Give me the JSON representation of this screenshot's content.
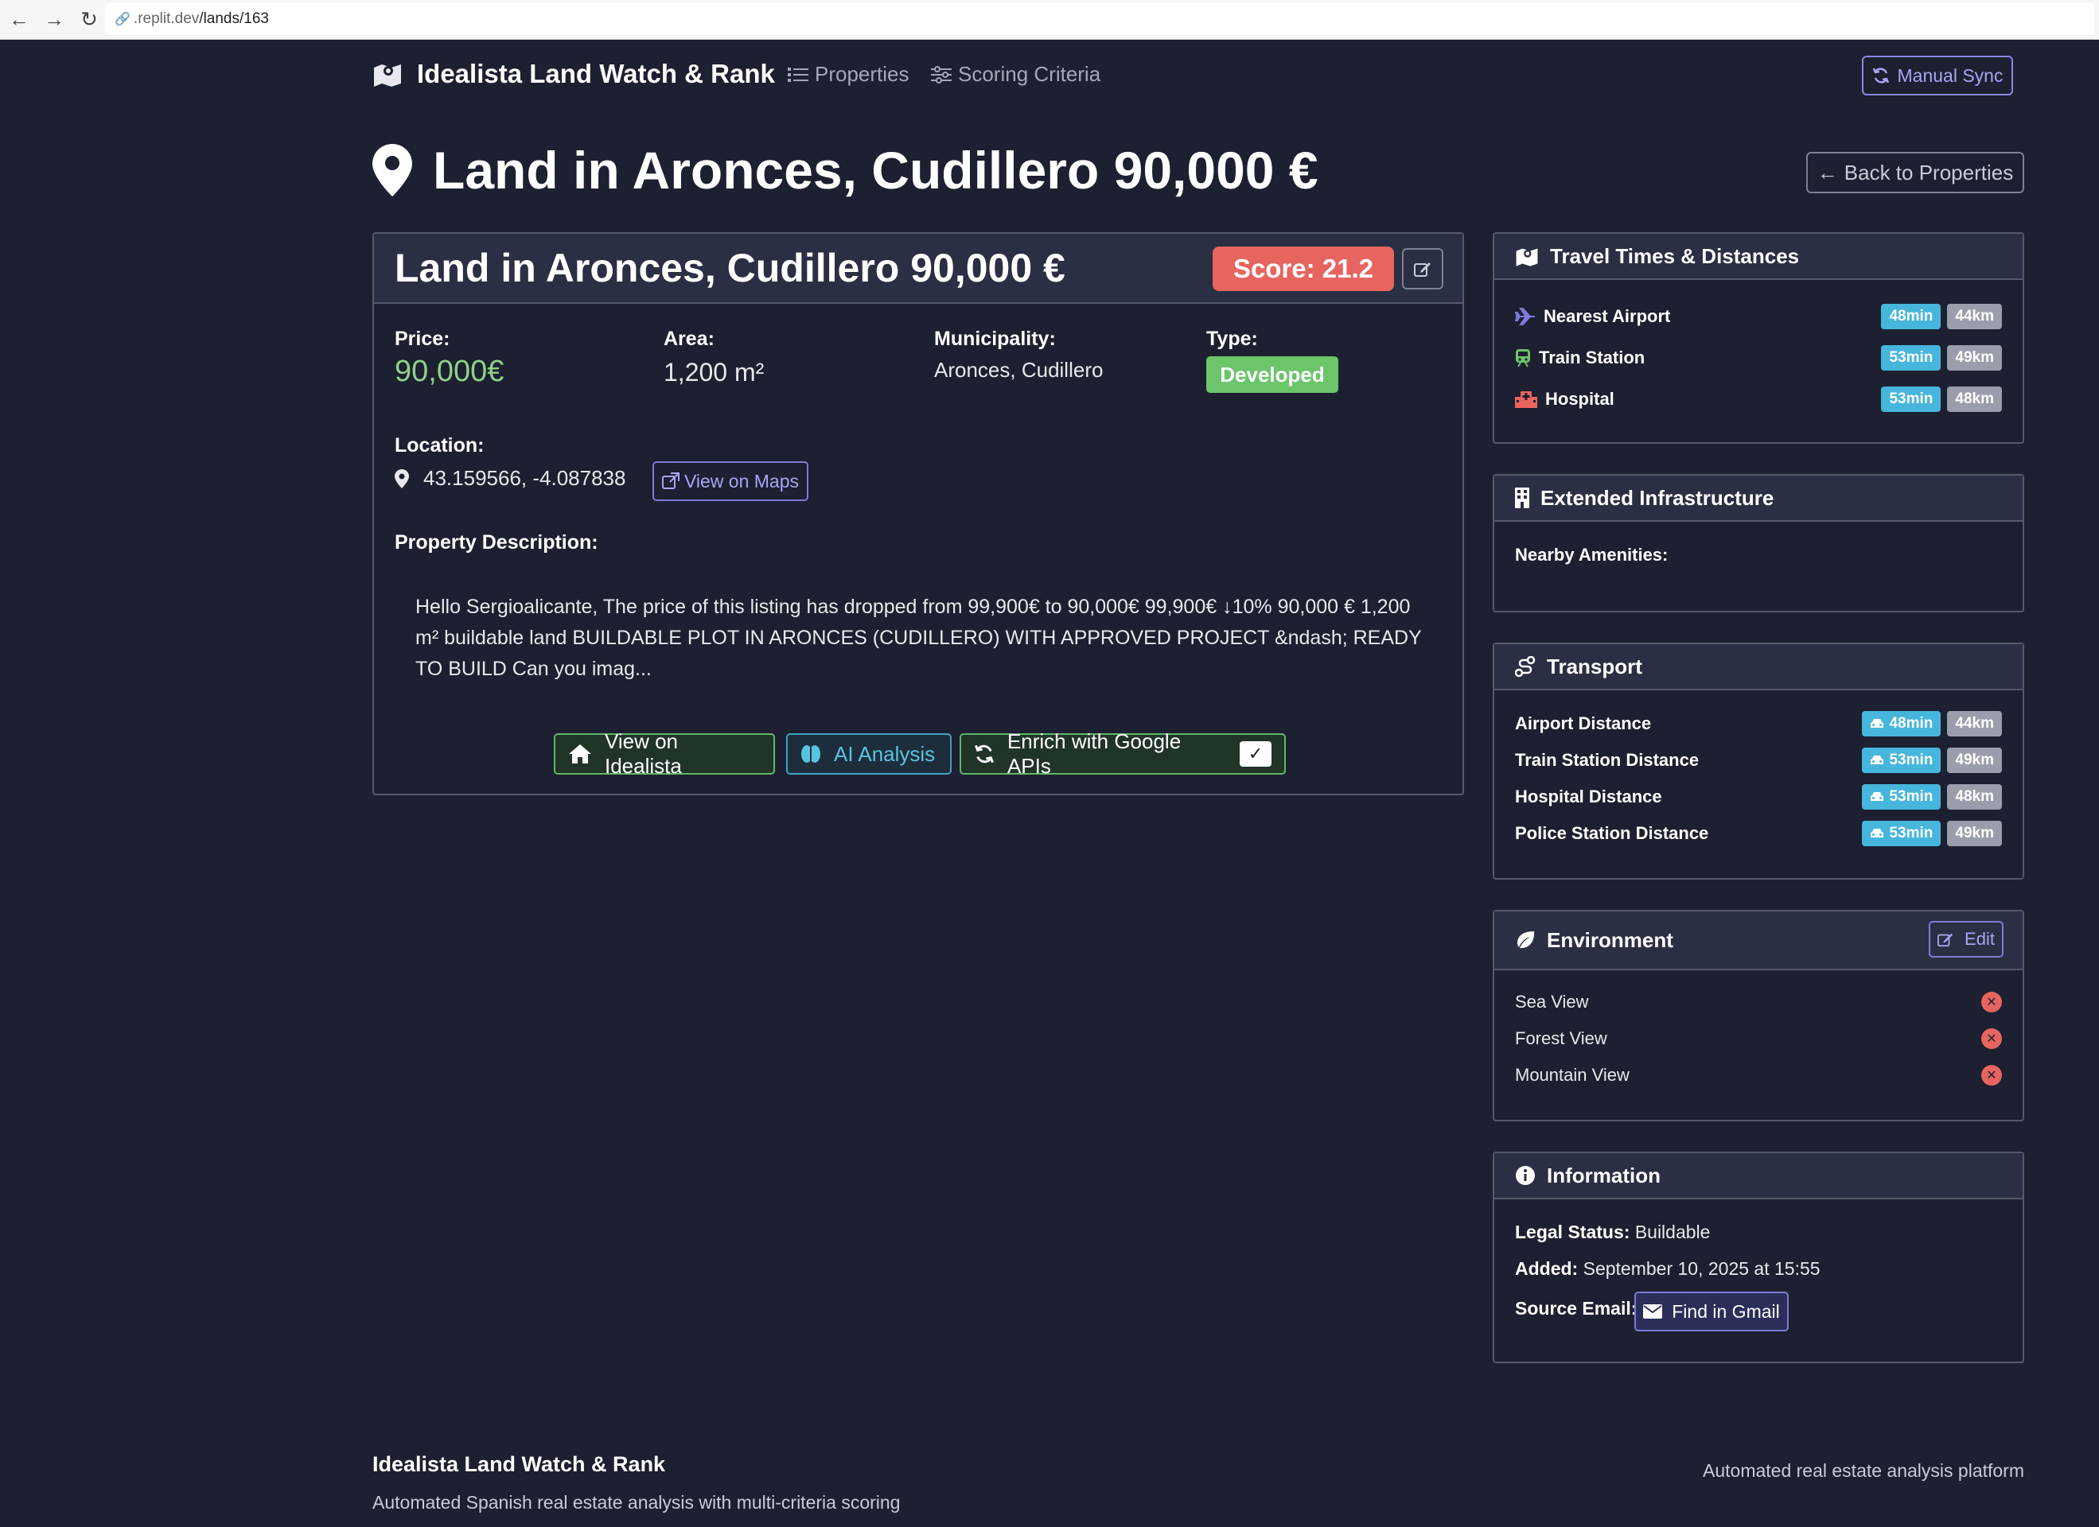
{
  "browser": {
    "url_host": ".replit.dev",
    "url_path": "/lands/163"
  },
  "navbar": {
    "brand": "Idealista Land Watch & Rank",
    "links": [
      "Properties",
      "Scoring Criteria"
    ],
    "sync_button": "Manual Sync"
  },
  "page": {
    "title": "Land in Aronces, Cudillero 90,000 €",
    "back_button": "Back to Properties"
  },
  "property": {
    "card_title": "Land in Aronces, Cudillero 90,000 €",
    "score": "Score: 21.2",
    "price_label": "Price:",
    "price_value": "90,000€",
    "area_label": "Area:",
    "area_value": "1,200 m²",
    "municipality_label": "Municipality:",
    "municipality_value": "Aronces, Cudillero",
    "type_label": "Type:",
    "type_value": "Developed",
    "location_label": "Location:",
    "coordinates": "43.159566, -4.087838",
    "maps_button": "View on Maps",
    "description_label": "Property Description:",
    "description": "Hello Sergioalicante, The price of this listing has dropped from 99,900€ to 90,000€ 99,900€ ↓10% 90,000 € 1,200 m² buildable land BUILDABLE PLOT IN ARONCES (CUDILLERO) WITH APPROVED PROJECT &ndash; READY TO BUILD Can you imag...",
    "actions": {
      "idealista": "View on Idealista",
      "ai": "AI Analysis",
      "enrich": "Enrich with Google APIs",
      "enrich_check": "✓"
    }
  },
  "travel": {
    "title": "Travel Times & Distances",
    "rows": [
      {
        "label": "Nearest Airport",
        "time": "48min",
        "dist": "44km"
      },
      {
        "label": "Train Station",
        "time": "53min",
        "dist": "49km"
      },
      {
        "label": "Hospital",
        "time": "53min",
        "dist": "48km"
      }
    ]
  },
  "infrastructure": {
    "title": "Extended Infrastructure",
    "amenities_label": "Nearby Amenities:"
  },
  "transport": {
    "title": "Transport",
    "rows": [
      {
        "label": "Airport Distance",
        "time": "48min",
        "dist": "44km"
      },
      {
        "label": "Train Station Distance",
        "time": "53min",
        "dist": "49km"
      },
      {
        "label": "Hospital Distance",
        "time": "53min",
        "dist": "48km"
      },
      {
        "label": "Police Station Distance",
        "time": "53min",
        "dist": "49km"
      }
    ]
  },
  "environment": {
    "title": "Environment",
    "edit_button": "Edit",
    "rows": [
      "Sea View",
      "Forest View",
      "Mountain View"
    ]
  },
  "information": {
    "title": "Information",
    "legal_label": "Legal Status:",
    "legal_value": "Buildable",
    "added_label": "Added:",
    "added_value": "September 10, 2025 at 15:55",
    "source_label": "Source Email:",
    "gmail_button": "Find in Gmail"
  },
  "footer": {
    "title": "Idealista Land Watch & Rank",
    "subtitle": "Automated Spanish real estate analysis with multi-criteria scoring",
    "right": "Automated real estate analysis platform"
  },
  "colors": {
    "background": "#1c2030",
    "accent": "#8c87e8",
    "score": "#e8645f",
    "success": "#6cc46b",
    "info": "#46b6dc"
  }
}
